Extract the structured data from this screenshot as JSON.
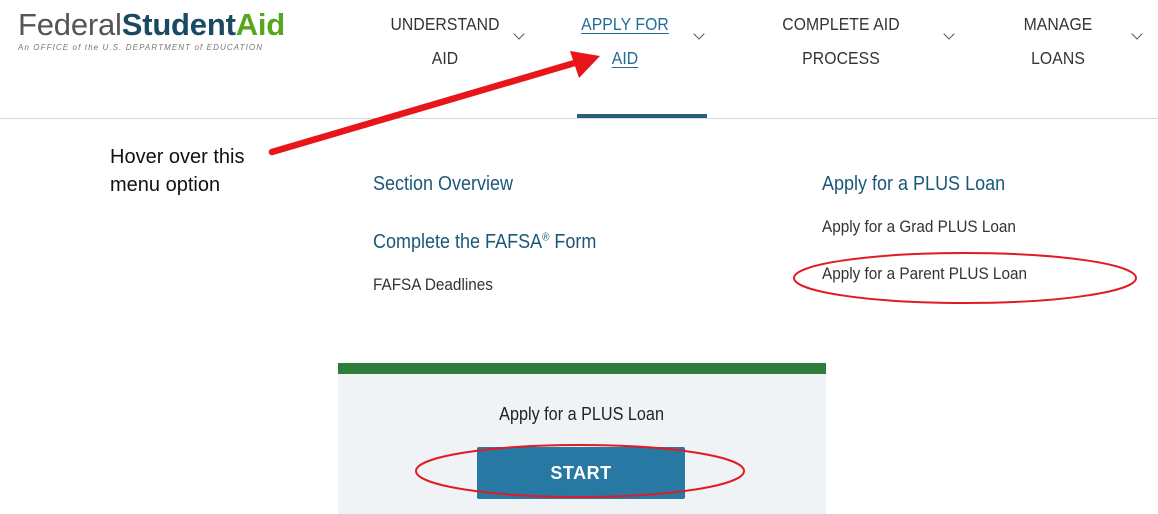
{
  "header": {
    "logo": {
      "word1": "Federal",
      "word2": "Student",
      "word3": "Aid",
      "tagline": "An OFFICE of the U.S. DEPARTMENT of EDUCATION"
    },
    "nav": [
      {
        "line1": "UNDERSTAND",
        "line2": "AID",
        "active": false
      },
      {
        "line1": "APPLY FOR",
        "line2": "AID",
        "active": true
      },
      {
        "line1": "COMPLETE AID",
        "line2": "PROCESS",
        "active": false
      },
      {
        "line1": "MANAGE",
        "line2": "LOANS",
        "active": false
      }
    ]
  },
  "annotation": {
    "line1": "Hover over this",
    "line2": "menu option",
    "arrow_color": "#e8151b",
    "highlight_color": "#e01b24"
  },
  "dropdown": {
    "col1": {
      "overview": "Section Overview",
      "fafsa": "Complete the FAFSA",
      "fafsa_reg": "®",
      "fafsa_suffix": " Form",
      "deadlines": "FAFSA Deadlines"
    },
    "col2": {
      "plus": "Apply for a PLUS Loan",
      "grad": "Apply for a Grad PLUS Loan",
      "parent": "Apply for a Parent PLUS Loan"
    }
  },
  "cta": {
    "title": "Apply for a PLUS Loan",
    "button": "START",
    "top_bar_color": "#2f7d3a",
    "button_color": "#2778a3"
  }
}
